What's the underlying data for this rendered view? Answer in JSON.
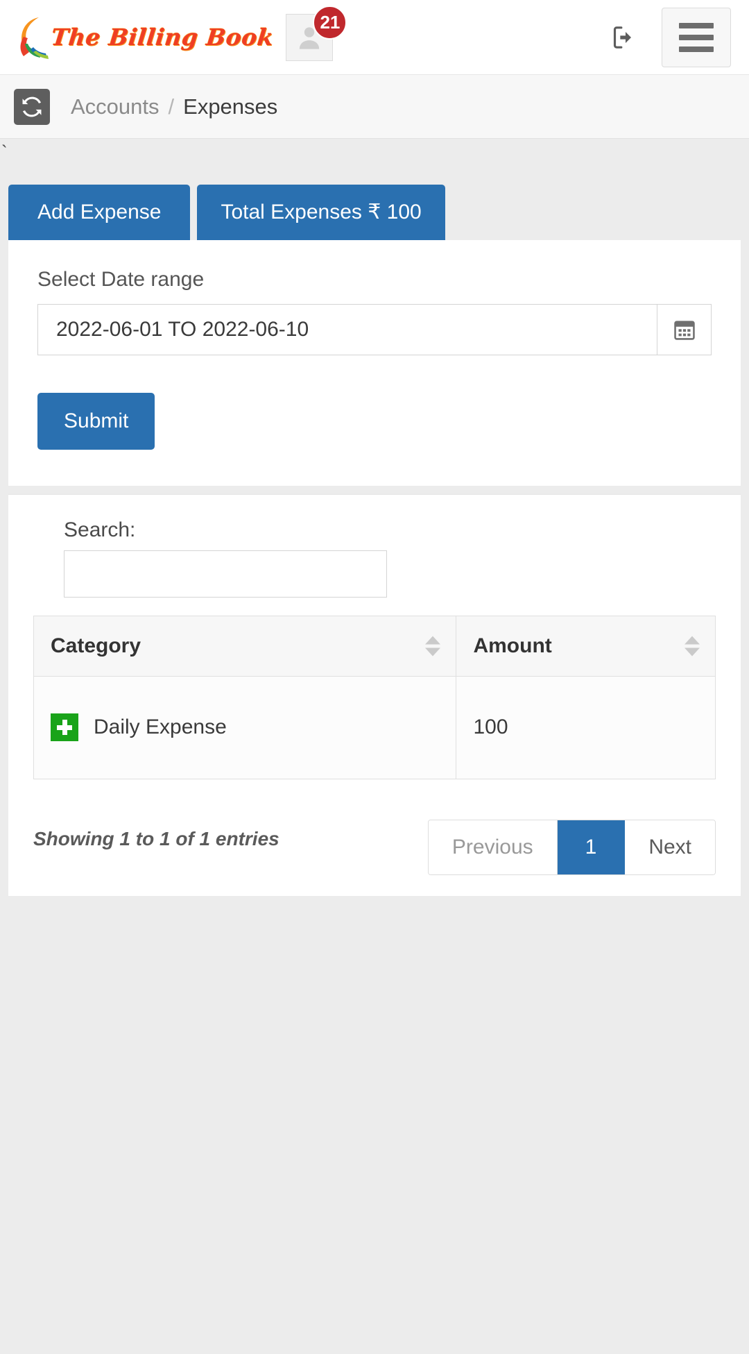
{
  "header": {
    "brand_name": "The Billing Book",
    "notification_count": "21",
    "avatar_icon": "user-avatar-icon",
    "logout_icon": "logout-icon",
    "menu_icon": "hamburger-menu-icon"
  },
  "breadcrumb": {
    "refresh_icon": "refresh-icon",
    "parent": "Accounts",
    "separator": "/",
    "current": "Expenses"
  },
  "content": {
    "stray_text": "`",
    "buttons": {
      "add_expense": "Add Expense",
      "total_expenses": "Total Expenses ₹ 100"
    },
    "filter": {
      "date_label": "Select Date range",
      "date_value": "2022-06-01 TO 2022-06-10",
      "date_placeholder": "Select Date range",
      "calendar_icon": "calendar-icon",
      "submit_label": "Submit"
    },
    "table": {
      "search_label": "Search:",
      "search_value": "",
      "search_placeholder": "",
      "columns": [
        "Category",
        "Amount"
      ],
      "rows": [
        {
          "icon": "plus-icon",
          "category": "Daily Expense",
          "amount": "100"
        }
      ],
      "entries_info": "Showing 1 to 1 of 1 entries",
      "pagination": {
        "previous": "Previous",
        "pages": [
          "1"
        ],
        "next": "Next",
        "current": "1"
      }
    }
  },
  "colors": {
    "primary": "#2a70b0",
    "badge": "#c0282d",
    "brand_red": "#ef3e24",
    "brand_orange": "#f7941e",
    "success_green": "#19a319",
    "page_bg": "#ececec"
  }
}
